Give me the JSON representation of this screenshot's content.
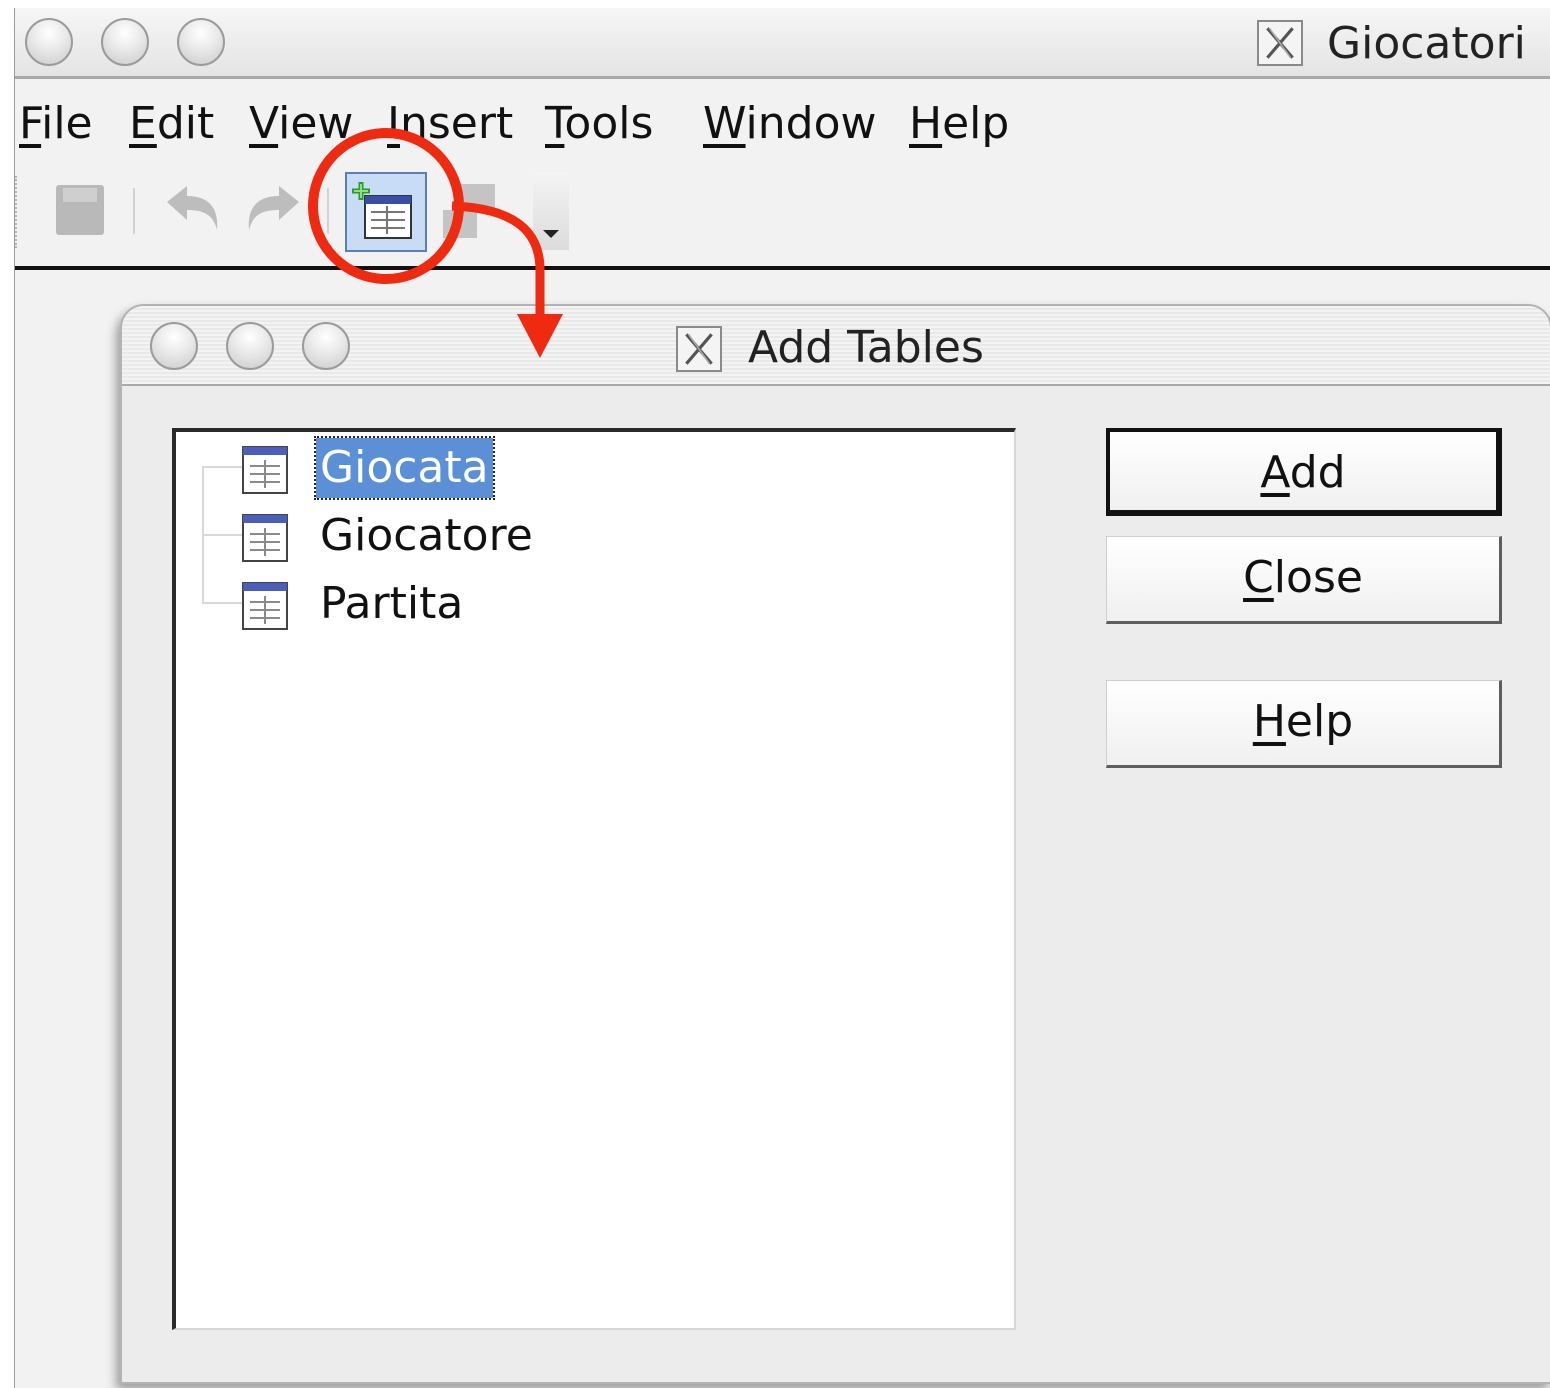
{
  "main_window": {
    "title": "Giocatori"
  },
  "menu": [
    {
      "label": "File",
      "mnemonic_index": 0
    },
    {
      "label": "Edit",
      "mnemonic_index": 0
    },
    {
      "label": "View",
      "mnemonic_index": 0
    },
    {
      "label": "Insert",
      "mnemonic_index": 0
    },
    {
      "label": "Tools",
      "mnemonic_index": 0
    },
    {
      "label": "Window",
      "mnemonic_index": 0
    },
    {
      "label": "Help",
      "mnemonic_index": 0
    }
  ],
  "toolbar": {
    "icons": [
      "save-icon",
      "undo-icon",
      "redo-icon",
      "add-tables-icon",
      "relations-icon",
      "toolbar-overflow-icon"
    ],
    "highlighted": "add-tables-icon"
  },
  "annotation": {
    "color": "#ee2a10"
  },
  "dialog": {
    "title": "Add Tables",
    "tables": [
      {
        "label": "Giocata",
        "selected": true
      },
      {
        "label": "Giocatore",
        "selected": false
      },
      {
        "label": "Partita",
        "selected": false
      }
    ],
    "buttons": {
      "add": "Add",
      "close": "Close",
      "help": "Help"
    }
  },
  "colors": {
    "selection": "#5b8fd6",
    "highlight_button": "#c8dcf5"
  }
}
